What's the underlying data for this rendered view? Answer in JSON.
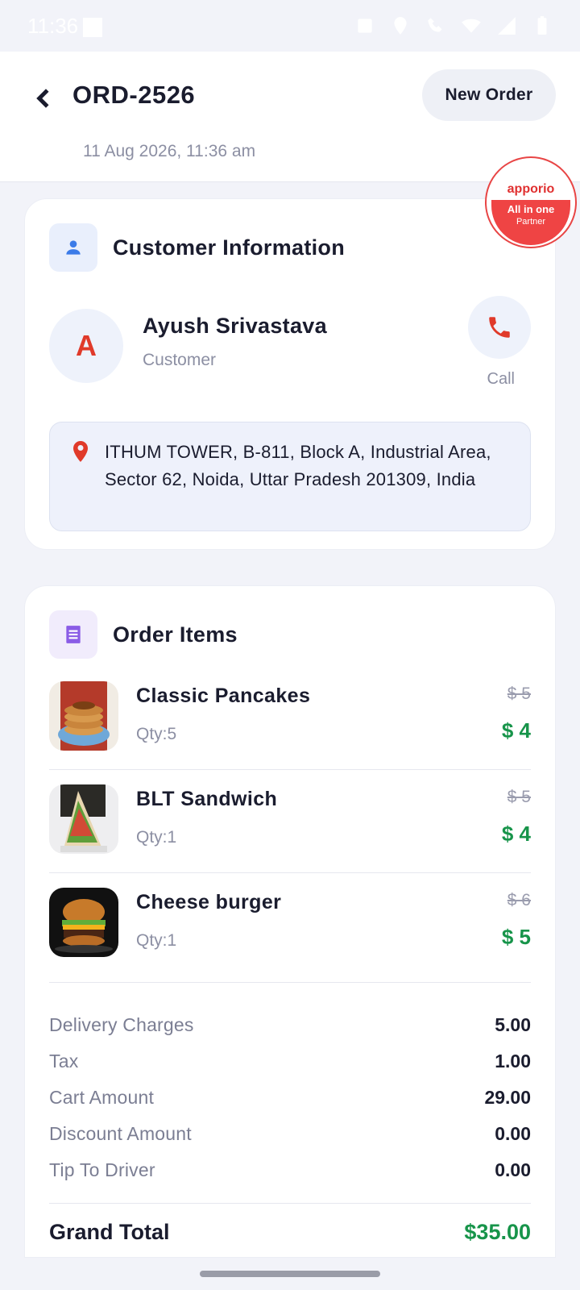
{
  "status_bar": {
    "time": "11:36"
  },
  "header": {
    "order_id": "ORD-2526",
    "date": "11 Aug 2026, 11:36 am",
    "new_order_label": "New Order"
  },
  "badge": {
    "brand": "apporio",
    "line1": "All in one",
    "line2": "Partner"
  },
  "customer": {
    "section_title": "Customer Information",
    "avatar_initial": "A",
    "name": "Ayush Srivastava",
    "role": "Customer",
    "call_label": "Call",
    "address": "ITHUM TOWER, B-811, Block A, Industrial Area, Sector 62, Noida, Uttar Pradesh 201309, India"
  },
  "order": {
    "section_title": "Order Items",
    "items": [
      {
        "name": "Classic Pancakes",
        "qty": "Qty:5",
        "old_price": "$ 5",
        "price": "$ 4"
      },
      {
        "name": "BLT Sandwich",
        "qty": "Qty:1",
        "old_price": "$ 5",
        "price": "$ 4"
      },
      {
        "name": "Cheese burger",
        "qty": "Qty:1",
        "old_price": "$ 6",
        "price": "$ 5"
      }
    ],
    "summary": [
      {
        "label": "Delivery Charges",
        "value": "5.00"
      },
      {
        "label": "Tax",
        "value": "1.00"
      },
      {
        "label": "Cart Amount",
        "value": "29.00"
      },
      {
        "label": "Discount Amount",
        "value": "0.00"
      },
      {
        "label": "Tip To Driver",
        "value": "0.00"
      }
    ],
    "grand_total_label": "Grand Total",
    "grand_total_value": "$35.00"
  },
  "colors": {
    "accent_green": "#17944a",
    "accent_red": "#e03a2a"
  }
}
